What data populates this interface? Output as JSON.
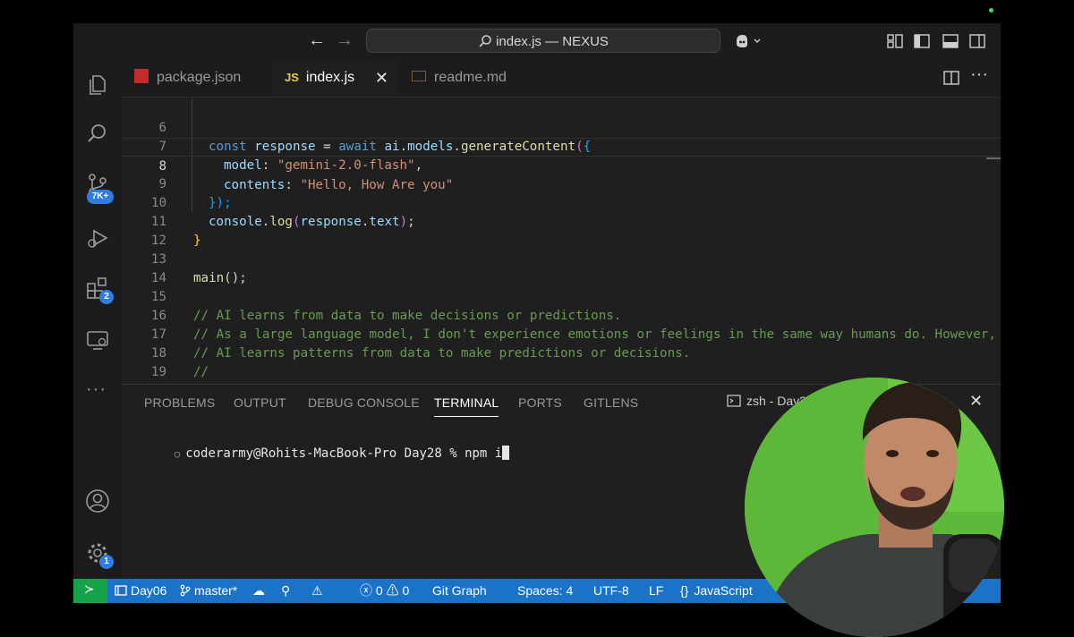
{
  "window": {
    "title": "index.js — NEXUS"
  },
  "activity": {
    "source_control_badge": "7K+",
    "extensions_badge": "2",
    "settings_badge": "1"
  },
  "tabs": [
    {
      "label": "package.json",
      "icon": "npm-icon",
      "active": false
    },
    {
      "label": "index.js",
      "icon": "js-icon",
      "active": true,
      "icon_text": "JS"
    },
    {
      "label": "readme.md",
      "icon": "markdown-icon",
      "active": false
    }
  ],
  "editor": {
    "lines": [
      {
        "n": "6"
      },
      {
        "n": "7"
      },
      {
        "n": "8"
      },
      {
        "n": "9"
      },
      {
        "n": "10"
      },
      {
        "n": "11"
      },
      {
        "n": "12"
      },
      {
        "n": "13"
      },
      {
        "n": "14"
      },
      {
        "n": "15"
      },
      {
        "n": "16"
      },
      {
        "n": "17"
      },
      {
        "n": "18"
      },
      {
        "n": "19"
      }
    ],
    "code": {
      "l6_const": "const",
      "l6_response": "response",
      "l6_eq": " = ",
      "l6_await": "await",
      "l6_ai": "ai",
      "l6_models": "models",
      "l6_fn": "generateContent",
      "l7_key": "model",
      "l7_val": "\"gemini-2.0-flash\"",
      "l8_key": "contents",
      "l8_val": "\"Hello, How Are you\"",
      "l9_close": "});",
      "l10_console": "console",
      "l10_log": "log",
      "l10_response": "response",
      "l10_text": "text",
      "l11_close": "}",
      "l13_main": "main",
      "l13_rest": "();",
      "l15": "// AI learns from data to make decisions or predictions.",
      "l16": "// As a large language model, I don't experience emotions or feelings in the same way humans do. However,",
      "l17": "// AI learns patterns from data to make predictions or decisions.",
      "l18": "//",
      "l19": "//"
    }
  },
  "panel": {
    "tabs": [
      "PROBLEMS",
      "OUTPUT",
      "DEBUG CONSOLE",
      "TERMINAL",
      "PORTS",
      "GITLENS"
    ],
    "active_tab": "TERMINAL",
    "terminal_name": "zsh - Day2",
    "prompt": "coderarmy@Rohits-MacBook-Pro Day28 % npm i"
  },
  "statusbar": {
    "folder": "Day06",
    "branch": "master*",
    "errors": "0",
    "warnings": "0",
    "git_graph": "Git Graph",
    "spaces": "Spaces: 4",
    "encoding": "UTF-8",
    "eol": "LF",
    "language": "JavaScript"
  },
  "colors": {
    "status_bar": "#1a73c8",
    "remote_indicator": "#15a34a",
    "webcam_background": "#5db83a"
  }
}
